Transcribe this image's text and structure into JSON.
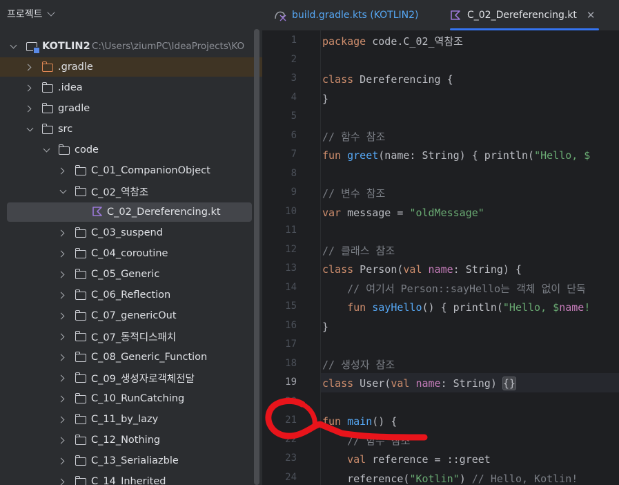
{
  "sidebar": {
    "title": "프로젝트",
    "root": {
      "name": "KOTLIN2",
      "path": "C:\\Users\\ziumPC\\IdeaProjects\\KO"
    },
    "items": [
      {
        "label": ".gradle"
      },
      {
        "label": ".idea"
      },
      {
        "label": "gradle"
      },
      {
        "label": "src"
      },
      {
        "label": "code"
      },
      {
        "label": "C_01_CompanionObject"
      },
      {
        "label": "C_02_역참조"
      },
      {
        "label": "C_02_Dereferencing.kt"
      },
      {
        "label": "C_03_suspend"
      },
      {
        "label": "C_04_coroutine"
      },
      {
        "label": "C_05_Generic"
      },
      {
        "label": "C_06_Reflection"
      },
      {
        "label": "C_07_genericOut"
      },
      {
        "label": "C_07_동적디스패치"
      },
      {
        "label": "C_08_Generic_Function"
      },
      {
        "label": "C_09_생성자로객체전달"
      },
      {
        "label": "C_10_RunCatching"
      },
      {
        "label": "C_11_by_lazy"
      },
      {
        "label": "C_12_Nothing"
      },
      {
        "label": "C_13_Serialiazble"
      },
      {
        "label": "C_14_Inherited"
      }
    ]
  },
  "tabs": [
    {
      "label": "build.gradle.kts (KOTLIN2)",
      "active": false
    },
    {
      "label": "C_02_Dereferencing.kt",
      "active": true
    }
  ],
  "editor": {
    "current_line": 19,
    "line_numbers": [
      "1",
      "2",
      "3",
      "4",
      "5",
      "6",
      "7",
      "8",
      "9",
      "10",
      "11",
      "12",
      "13",
      "14",
      "15",
      "16",
      "17",
      "18",
      "19",
      "20",
      "21",
      "22",
      "23",
      "24"
    ],
    "code": {
      "l1": [
        "package",
        " code.C_02_역참조"
      ],
      "l3": [
        "class",
        " Dereferencing {"
      ],
      "l4": "}",
      "l6": "// 함수 참조",
      "l7": [
        "fun",
        " ",
        "greet",
        "(name: String) { println(",
        "\"Hello, $"
      ],
      "l9": "// 변수 참조",
      "l10": [
        "var",
        " message = ",
        "\"oldMessage\""
      ],
      "l12": "// 클래스 참조",
      "l13": [
        "class",
        " Person(",
        "val",
        " ",
        "name",
        ": String) {"
      ],
      "l14": "    // 여기서 Person::sayHello는 객체 없이 단독",
      "l15": [
        "    ",
        "fun",
        " ",
        "sayHello",
        "() { println(",
        "\"Hello, $",
        "name",
        "!"
      ],
      "l16": "}",
      "l18": "// 생성자 참조",
      "l19": [
        "class",
        " User(",
        "val",
        " ",
        "name",
        ": String) ",
        "{}"
      ],
      "l21": [
        "fun",
        " ",
        "main",
        "() {"
      ],
      "l22": "    // 함수 참조",
      "l23": [
        "    ",
        "val",
        " reference = ::greet"
      ],
      "l24": [
        "    reference(",
        "\"Kotlin\"",
        ") ",
        "// Hello, Kotlin!"
      ]
    }
  },
  "colors": {
    "accent": "#3574f0",
    "annotation": "#e8141b"
  }
}
